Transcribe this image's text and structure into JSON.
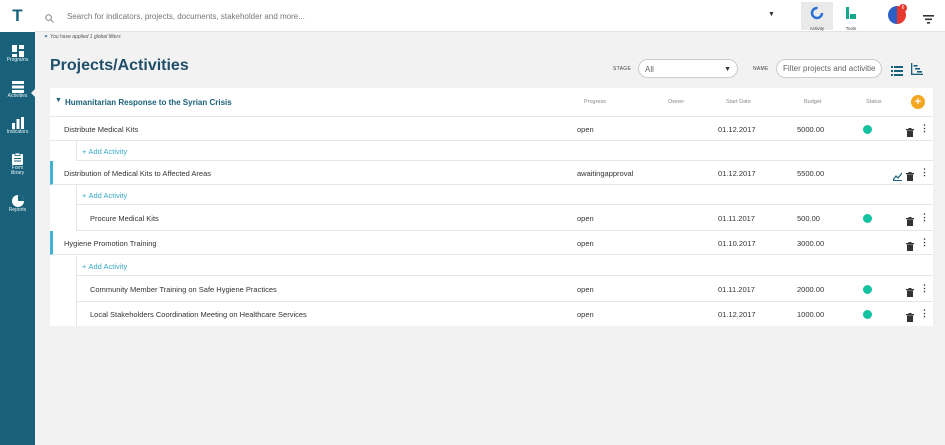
{
  "app": {
    "logo": "T"
  },
  "sidebar": {
    "items": [
      {
        "label": "Programs",
        "icon": "dashboard-icon"
      },
      {
        "label": "Activities",
        "icon": "list-icon",
        "active": true
      },
      {
        "label": "Indicators",
        "icon": "bar-chart-icon"
      },
      {
        "label": "Form library",
        "icon": "clipboard-icon"
      },
      {
        "label": "Reports",
        "icon": "pie-chart-icon"
      }
    ]
  },
  "topbar": {
    "search_placeholder": "Search for indicators, projects, documents, stakeholder and more...",
    "activity_label": "Activity",
    "tools_label": "Tools",
    "notification_count": "6"
  },
  "filter_note": "You have applied 1 global filters",
  "header": {
    "title": "Projects/Activities",
    "stage_label": "STAGE",
    "stage_value": "All",
    "name_label": "NAME",
    "name_placeholder": "Filter projects and activities"
  },
  "table": {
    "group_title": "Humanitarian Response to the Syrian Crisis",
    "columns": [
      "Progress",
      "Owner",
      "Start Date",
      "Budget",
      "Status"
    ],
    "add_activity_label": "Add Activity",
    "rows": [
      {
        "name": "Distribute Medical Kits",
        "progress": "open",
        "start": "01.12.2017",
        "budget": "5000.00",
        "status": "green"
      },
      {
        "name": "Distribution of Medical Kits to Affected Areas",
        "progress": "awaitingapproval",
        "start": "01.12.2017",
        "budget": "5500.00",
        "status": ""
      },
      {
        "name": "Procure Medical Kits",
        "progress": "open",
        "start": "01.11.2017",
        "budget": "500.00",
        "status": "green"
      },
      {
        "name": "Hygiene Promotion Training",
        "progress": "open",
        "start": "01.10.2017",
        "budget": "3000.00",
        "status": ""
      },
      {
        "name": "Community Member Training on Safe Hygiene Practices",
        "progress": "open",
        "start": "01.11.2017",
        "budget": "2000.00",
        "status": "green"
      },
      {
        "name": "Local Stakeholders Coordination Meeting on Healthcare Services",
        "progress": "open",
        "start": "01.12.2017",
        "budget": "1000.00",
        "status": "green"
      }
    ]
  },
  "colors": {
    "sidebar": "#19617a",
    "accent": "#3aa8c9",
    "status_green": "#15c2a0",
    "add_button": "#f5a623"
  }
}
